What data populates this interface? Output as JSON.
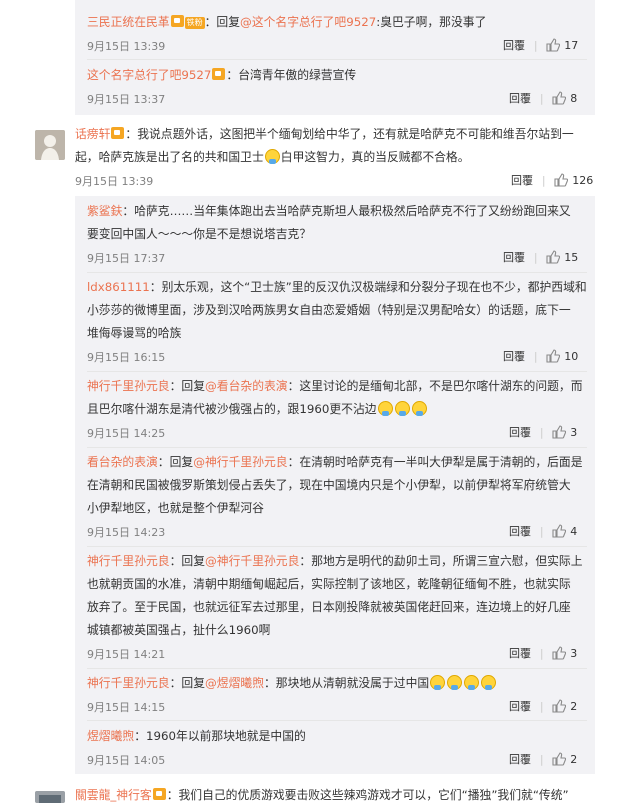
{
  "comments": [
    {
      "user": "三民正统在民革",
      "reply_word": "回复",
      "mention": "@这个名字总行了吧9527",
      "text": ":臭巴子啊，那没事了",
      "time": "9月15日 13:39",
      "reply": "回覆",
      "likes": "17"
    },
    {
      "user": "这个名字总行了吧9527",
      "text": "：台湾青年傲的绿营宣传",
      "time": "9月15日 13:37",
      "reply": "回覆",
      "likes": "8"
    },
    {
      "user": "话痨轩",
      "line1": "：我说点题外话，这图把半个缅甸划给中华了，还有就是哈萨克不可能和维吾尔站到一",
      "line2a": "起，哈萨克族是出了名的共和国卫士",
      "line2b": "白甲这智力，真的当反贼都不合格。",
      "time": "9月15日 13:39",
      "reply": "回覆",
      "likes": "126"
    },
    {
      "user": "紫鲨鈇",
      "line1": "：哈萨克……当年集体跑出去当哈萨克斯坦人最积极然后哈萨克不行了又纷纷跑回来又",
      "line2": "要变回中国人～～～你是不是想说塔吉克？",
      "time": "9月15日 17:37",
      "reply": "回覆",
      "likes": "15"
    },
    {
      "user": "ldx861111",
      "line1": "：别太乐观，这个“卫士族”里的反汉仇汉极端绿和分裂分子现在也不少，都护西域和",
      "line2": "小莎莎的微博里面，涉及到汉哈两族男女自由恋爱婚姻（特别是汉男配哈女）的话题，底下一",
      "line3": "堆侮辱谩骂的哈族",
      "time": "9月15日 16:15",
      "reply": "回覆",
      "likes": "10"
    },
    {
      "user": "神行千里孙元良",
      "reply_word": "：回复",
      "mention": "@看台杂的表演",
      "line1": "：这里讨论的是缅甸北部，不是巴尔喀什湖东的问题，而",
      "line2": "且巴尔喀什湖东是清代被沙俄强占的，跟1960更不沾边",
      "time": "9月15日 14:25",
      "reply": "回覆",
      "likes": "3"
    },
    {
      "user": "看台杂的表演",
      "reply_word": "：回复",
      "mention": "@神行千里孙元良",
      "line1": "：在清朝时哈萨克有一半叫大伊犁是属于清朝的，后面是",
      "line2": "在清朝和民国被俄罗斯策划侵占丢失了，现在中国境内只是个小伊犁，以前伊犁将军府统管大",
      "line3": "小伊犁地区，也就是整个伊犁河谷",
      "time": "9月15日 14:23",
      "reply": "回覆",
      "likes": "4"
    },
    {
      "user": "神行千里孙元良",
      "reply_word": "：回复",
      "mention": "@神行千里孙元良",
      "line1": "：那地方是明代的勐卯土司，所谓三宣六慰，但实际上",
      "line2": "也就朝贡国的水准，清朝中期缅甸崛起后，实际控制了该地区，乾隆朝征缅甸不胜，也就实际",
      "line3": "放弃了。至于民国，也就远征军去过那里，日本刚投降就被英国佬赶回来，连边境上的好几座",
      "line4": "城镇都被英国强占，扯什么1960啊",
      "time": "9月15日 14:21",
      "reply": "回覆",
      "likes": "3"
    },
    {
      "user": "神行千里孙元良",
      "reply_word": "：回复",
      "mention": "@煜熠曦煦",
      "text": "：那块地从清朝就没属于过中国",
      "time": "9月15日 14:15",
      "reply": "回覆",
      "likes": "2"
    },
    {
      "user": "煜熠曦煦",
      "text": "：1960年以前那块地就是中国的",
      "time": "9月15日 14:05",
      "reply": "回覆",
      "likes": "2"
    },
    {
      "user": "關雲龍_神行客",
      "text": "：我们自己的优质游戏要击败这些辣鸡游戏才可以，它们“播独”我们就“传统”"
    }
  ]
}
